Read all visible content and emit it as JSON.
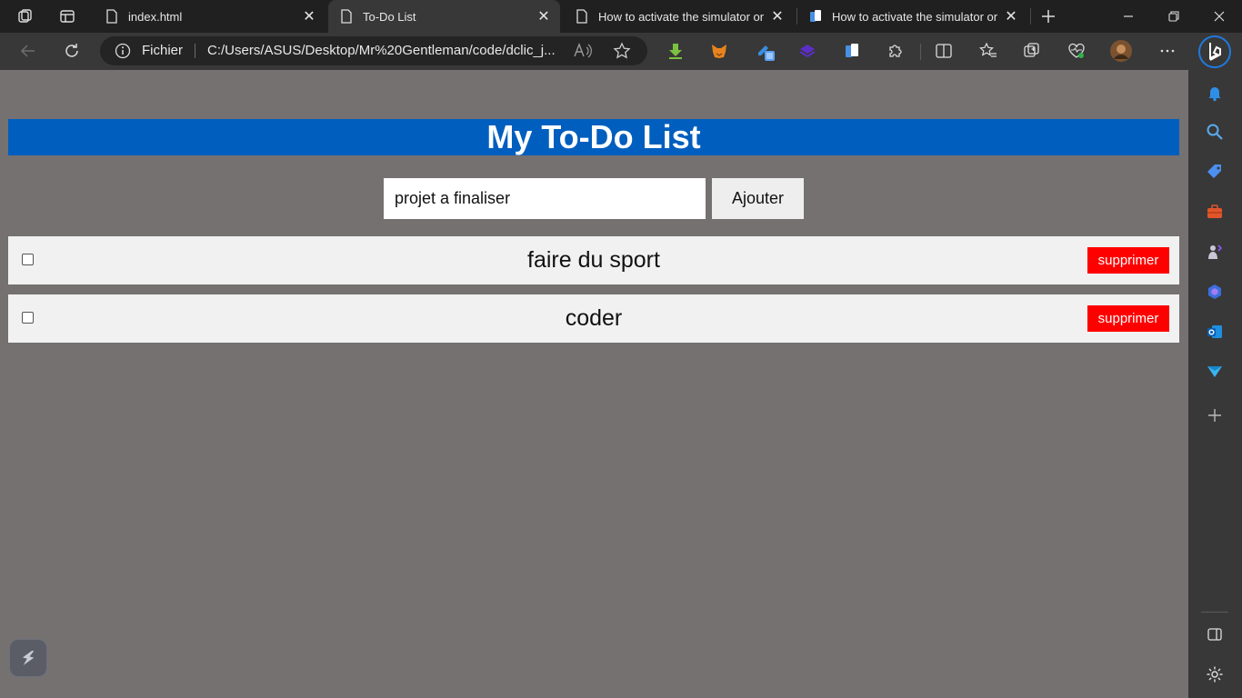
{
  "browser": {
    "tabs": [
      {
        "title": "index.html",
        "active": false
      },
      {
        "title": "To-Do List",
        "active": true
      },
      {
        "title": "How to activate the simulator or",
        "active": false
      },
      {
        "title": "How to activate the simulator or",
        "active": false
      }
    ],
    "close_glyph": "✕",
    "address": {
      "protocol_label": "Fichier",
      "url": "C:/Users/ASUS/Desktop/Mr%20Gentleman/code/dclic_j..."
    }
  },
  "app": {
    "title": "My To-Do List",
    "input": {
      "value": "projet a finaliser",
      "placeholder": ""
    },
    "add_label": "Ajouter",
    "tasks": [
      {
        "text": "faire du sport",
        "checked": false,
        "delete_label": "supprimer"
      },
      {
        "text": "coder",
        "checked": false,
        "delete_label": "supprimer"
      }
    ]
  },
  "colors": {
    "header_bg": "#005ebe",
    "page_bg": "#757171",
    "delete_bg": "#ff0000",
    "task_bg": "#f1f1f1"
  }
}
